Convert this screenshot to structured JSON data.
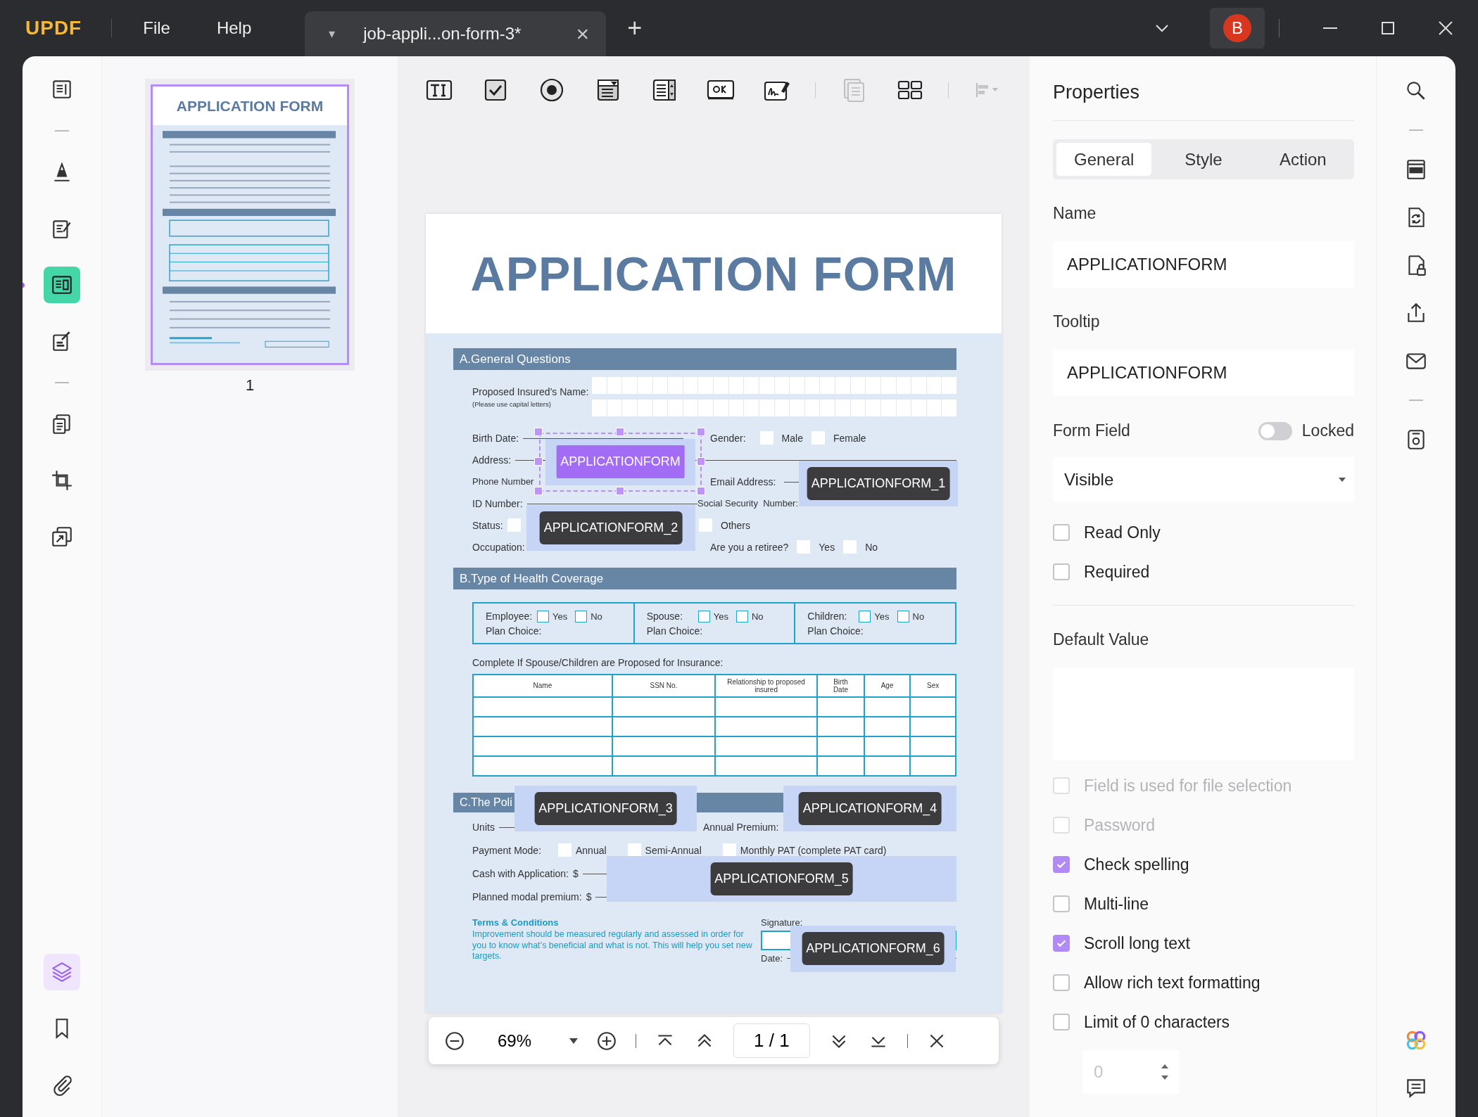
{
  "app": {
    "logo": "UPDF",
    "menu": [
      "File",
      "Help"
    ],
    "avatar": "B"
  },
  "tab": {
    "title": "job-appli...on-form-3*",
    "caret": "▾",
    "close": "×",
    "new": "+"
  },
  "left_tools": [
    {
      "kind": "reader",
      "selected": false
    },
    {
      "kind": "highlighter",
      "selected": false
    },
    {
      "kind": "editor",
      "selected": false
    },
    {
      "kind": "form",
      "selected": true
    },
    {
      "kind": "signer",
      "selected": false
    },
    {
      "kind": "pages",
      "selected": false
    },
    {
      "kind": "crop",
      "selected": false
    },
    {
      "kind": "stack",
      "selected": false
    },
    {
      "kind": "layers",
      "selected": true
    },
    {
      "kind": "bookmark",
      "selected": false
    },
    {
      "kind": "attachment",
      "selected": false
    }
  ],
  "thumbnail": {
    "title": "APPLICATION FORM",
    "page_label": "1",
    "selected": true
  },
  "form_tools": [
    {
      "kind": "text",
      "disabled": false
    },
    {
      "kind": "checkbox",
      "disabled": false
    },
    {
      "kind": "radio",
      "disabled": false
    },
    {
      "kind": "dropdown",
      "disabled": false
    },
    {
      "kind": "listbox",
      "disabled": false
    },
    {
      "kind": "button",
      "disabled": false
    },
    {
      "kind": "signature",
      "disabled": false
    },
    {
      "kind": "copy",
      "disabled": true
    },
    {
      "kind": "grid",
      "disabled": false
    },
    {
      "kind": "align",
      "disabled": true
    }
  ],
  "document": {
    "title": "APPLICATION FORM",
    "section_a": {
      "heading": "A.General Questions",
      "name_label": "Proposed Insured’s Name:",
      "name_hint": "(Please use capital letters)",
      "birth_date": "Birth Date:",
      "gender": "Gender:",
      "gender_options": [
        {
          "label": "Male",
          "checked": false
        },
        {
          "label": "Female",
          "checked": false
        }
      ],
      "address": "Address:",
      "phone": "Phone Number",
      "email": "Email Address:",
      "id": "ID Number:",
      "ssn": "Social Security  Number:",
      "status": "Status:",
      "status_options": [
        {
          "checked": false
        },
        {
          "label": "Others",
          "checked": false
        }
      ],
      "occupation": "Occupation:",
      "retiree": "Are you a retiree?",
      "retiree_options": [
        {
          "label": "Yes",
          "checked": false
        },
        {
          "label": "No",
          "checked": false
        }
      ]
    },
    "section_b": {
      "heading": "B.Type of Health Coverage",
      "coverage": [
        {
          "label": "Employee:",
          "options": [
            {
              "label": "Yes",
              "checked": false
            },
            {
              "label": "No",
              "checked": false
            }
          ],
          "plan": "Plan Choice:"
        },
        {
          "label": "Spouse:",
          "options": [
            {
              "label": "Yes",
              "checked": false
            },
            {
              "label": "No",
              "checked": false
            }
          ],
          "plan": "Plan Choice:"
        },
        {
          "label": "Children:",
          "options": [
            {
              "label": "Yes",
              "checked": false
            },
            {
              "label": "No",
              "checked": false
            }
          ],
          "plan": "Plan Choice:"
        }
      ],
      "note": "Complete If Spouse/Children are Proposed for Insurance:",
      "columns": [
        "Name",
        "SSN No.",
        "Relationship to proposed insured",
        "Birth Date",
        "Age",
        "Sex"
      ]
    },
    "section_c": {
      "heading": "C.The Poli",
      "units": "Units",
      "annual_premium": "Annual Premium:",
      "payment_mode": "Payment Mode:",
      "modes": [
        {
          "label": "Annual",
          "checked": false
        },
        {
          "label": "Semi-Annual",
          "checked": false
        },
        {
          "label": "Monthly PAT (complete PAT card)",
          "checked": false
        }
      ],
      "cash": "Cash with Application:",
      "cash_sign": "$",
      "planned": "Planned modal premium:",
      "planned_sign": "$",
      "terms_title": "Terms & Conditions",
      "terms_body": "Improvement should be measured regularly and assessed in order for you to know what’s beneficial and what is not. This will help you set new targets.",
      "signature": "Signature:",
      "date": "Date:"
    }
  },
  "fields": [
    {
      "label": "APPLICATIONFORM",
      "selected": true
    },
    {
      "label": "APPLICATIONFORM_1",
      "selected": false
    },
    {
      "label": "APPLICATIONFORM_2",
      "selected": false
    },
    {
      "label": "APPLICATIONFORM_3",
      "selected": false
    },
    {
      "label": "APPLICATIONFORM_4",
      "selected": false
    },
    {
      "label": "APPLICATIONFORM_5",
      "selected": false
    },
    {
      "label": "APPLICATIONFORM_6",
      "selected": false
    }
  ],
  "zoom_bar": {
    "zoom": "69%",
    "page_indicator": "1 / 1"
  },
  "properties": {
    "title": "Properties",
    "tabs": [
      {
        "label": "General",
        "selected": true
      },
      {
        "label": "Style",
        "selected": false
      },
      {
        "label": "Action",
        "selected": false
      }
    ],
    "name_label": "Name",
    "name_value": "APPLICATIONFORM",
    "tooltip_label": "Tooltip",
    "tooltip_value": "APPLICATIONFORM",
    "form_field_label": "Form Field",
    "locked_label": "Locked",
    "locked": false,
    "visibility": "Visible",
    "options_top": [
      {
        "label": "Read Only",
        "checked": false,
        "disabled": false
      },
      {
        "label": "Required",
        "checked": false,
        "disabled": false
      }
    ],
    "default_value_label": "Default Value",
    "options": [
      {
        "label": "Field is used for file selection",
        "checked": false,
        "disabled": true
      },
      {
        "label": "Password",
        "checked": false,
        "disabled": true
      },
      {
        "label": "Check spelling",
        "checked": true,
        "disabled": false
      },
      {
        "label": "Multi-line",
        "checked": false,
        "disabled": false
      },
      {
        "label": "Scroll long text",
        "checked": true,
        "disabled": false
      },
      {
        "label": "Allow rich text formatting",
        "checked": false,
        "disabled": false
      },
      {
        "label": "Limit of 0 characters",
        "checked": false,
        "disabled": false
      }
    ],
    "char_limit": "0",
    "char_limit_disabled": true
  }
}
